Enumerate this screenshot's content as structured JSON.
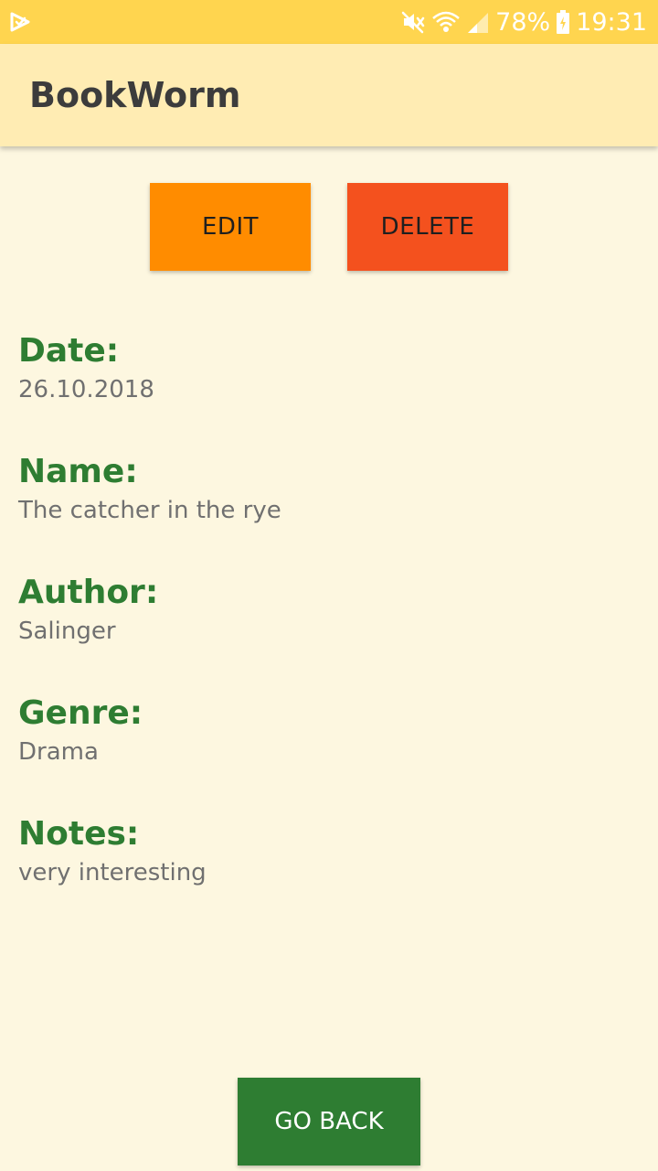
{
  "status_bar": {
    "battery": "78%",
    "time": "19:31",
    "icons": [
      "notification-icon",
      "mute-icon",
      "wifi-icon",
      "signal-icon",
      "battery-charging-icon"
    ]
  },
  "app_bar": {
    "title": "BookWorm"
  },
  "actions": {
    "edit_label": "EDIT",
    "delete_label": "DELETE"
  },
  "book": {
    "date_label": "Date:",
    "date": "26.10.2018",
    "name_label": "Name:",
    "name": "The catcher in the rye",
    "author_label": "Author:",
    "author": "Salinger",
    "genre_label": "Genre:",
    "genre": "Drama",
    "notes_label": "Notes:",
    "notes": "very interesting"
  },
  "footer": {
    "back_label": "GO BACK"
  },
  "colors": {
    "status_bar": "#FFD54F",
    "app_bar": "#FFECB3",
    "background": "#FDF7E0",
    "edit_button": "#FF8C00",
    "delete_button": "#F4511E",
    "label_green": "#2E7D32",
    "back_button": "#2E7D32"
  }
}
